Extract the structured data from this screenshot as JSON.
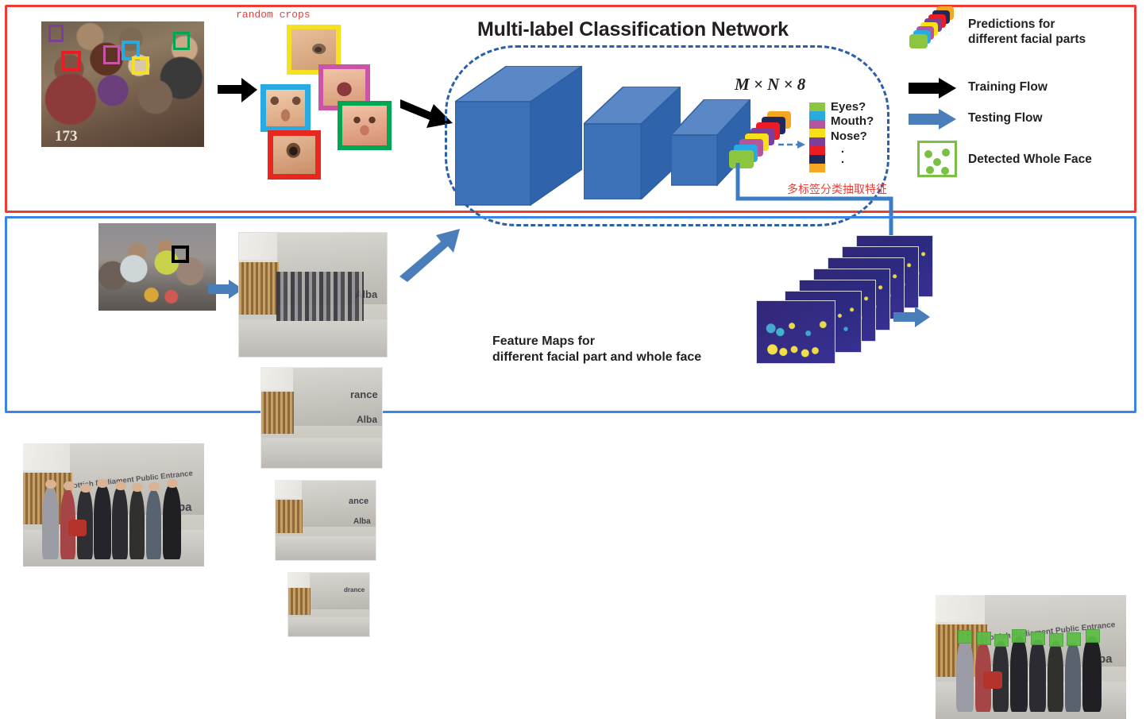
{
  "title": "Multi-label Classification Network",
  "annotations": {
    "random_crops": "random crops",
    "tensor_shape": "M × N × 8",
    "chinese_note": "多标签分类抽取特征",
    "feature_maps_line1": "Feature Maps for",
    "feature_maps_line2": "different facial part and whole face"
  },
  "class_questions": [
    "Eyes?",
    "Mouth?",
    "Nose?",
    ".",
    "."
  ],
  "legend": {
    "predictions_line1": "Predictions for",
    "predictions_line2": "different facial parts",
    "training_flow": "Training Flow",
    "testing_flow": "Testing Flow",
    "detected_whole_face": "Detected Whole Face"
  },
  "colors": {
    "train_panel_border": "#ee3b33",
    "test_panel_border": "#3a86e8",
    "training_arrow": "#000000",
    "testing_arrow": "#4a7ebb",
    "cnn_block_front": "#3c71b8",
    "cnn_block_top": "#5a87c6",
    "cnn_block_side": "#2f63ab",
    "dashed_box": "#2b5fa8",
    "chinese_note": "#e8403a",
    "random_crops_text": "#e8403a",
    "detected_face_green": "#7ac143",
    "label_classes": [
      "#8cc63f",
      "#29abe2",
      "#b4569f",
      "#f7e017",
      "#7b3f98",
      "#ed1c24",
      "#1f2a5a",
      "#f5a623"
    ]
  },
  "photos": {
    "source_crowd_caption_number": "173",
    "parliament_sign": "Scottish Parliament Public Entrance",
    "parliament_sign_short": "Alba",
    "pyramid_sign_fragments": [
      "rance",
      "ance",
      "drance",
      "Alba",
      "Alba",
      "Alba"
    ]
  },
  "crops": [
    {
      "name": "eye-crop-yellow",
      "border": "#f5e024"
    },
    {
      "name": "mouth-crop-magenta",
      "border": "#cc54a8"
    },
    {
      "name": "nose-crop-blue",
      "border": "#29abe2"
    },
    {
      "name": "eye-crop-red",
      "border": "#e8271f"
    },
    {
      "name": "face-crop-green",
      "border": "#00a651"
    }
  ],
  "source_boxes": [
    {
      "name": "box-purple",
      "color": "#7b3f98"
    },
    {
      "name": "box-red",
      "color": "#ed1c24"
    },
    {
      "name": "box-magenta",
      "color": "#cc54a8"
    },
    {
      "name": "box-blue",
      "color": "#29abe2"
    },
    {
      "name": "box-yellow",
      "color": "#f5e024"
    },
    {
      "name": "box-green",
      "color": "#00a651"
    },
    {
      "name": "box-black",
      "color": "#000000"
    }
  ],
  "prediction_stack_colors": [
    "#8cc63f",
    "#29abe2",
    "#b4569f",
    "#f7e017",
    "#7b3f98",
    "#ed1c24",
    "#1f2a5a",
    "#f5a623"
  ]
}
